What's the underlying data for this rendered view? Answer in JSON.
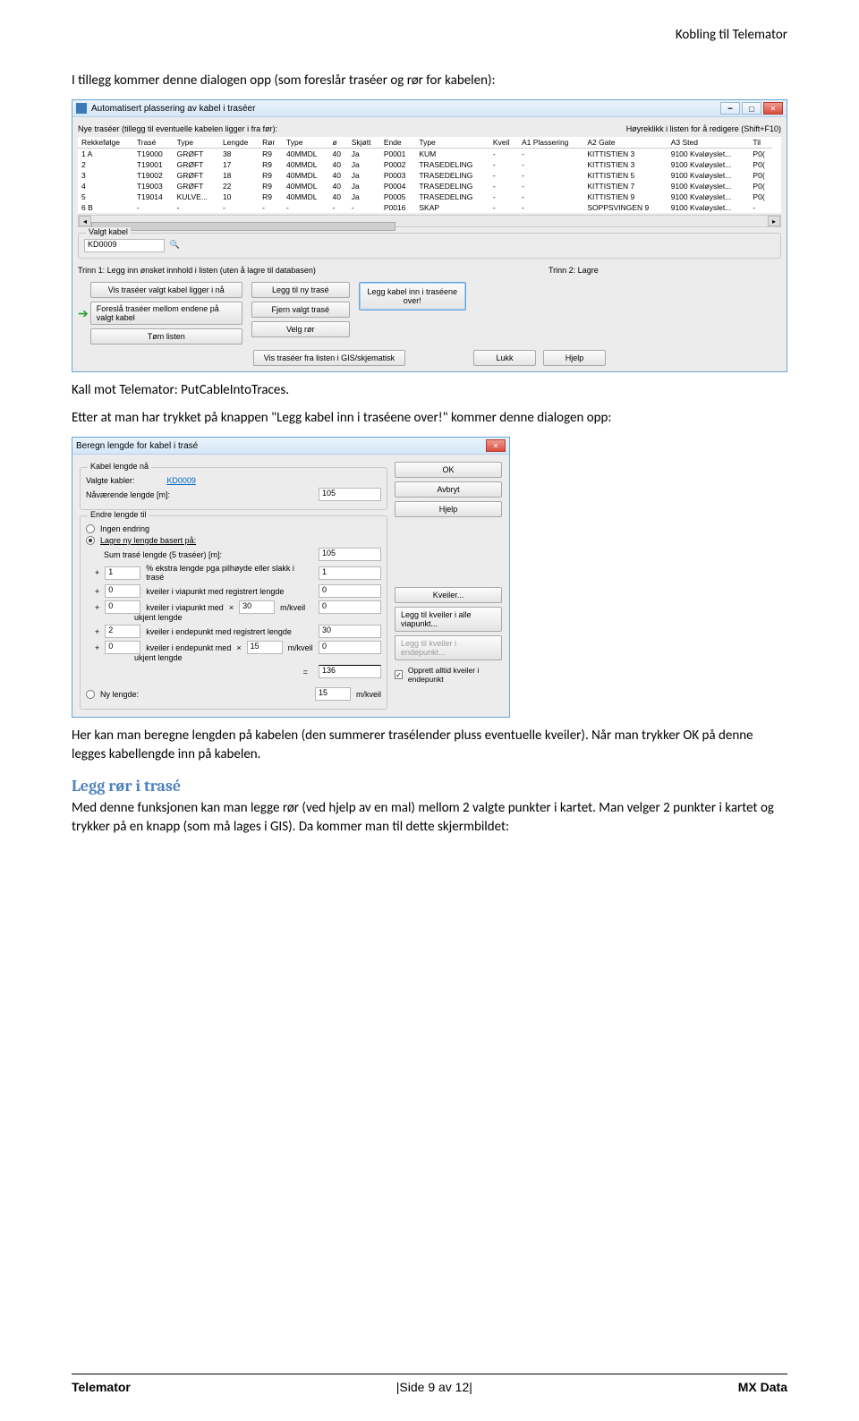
{
  "header": {
    "doc_title": "Kobling til Telemator"
  },
  "intro": {
    "p1": "I tillegg kommer denne dialogen opp (som foreslår traséer og rør for kabelen):"
  },
  "dlg1": {
    "title": "Automatisert plassering av kabel i traséer",
    "left_label": "Nye traséer (tillegg til eventuelle kabelen ligger i fra før):",
    "right_label": "Høyreklikk i listen for å redigere (Shift+F10)",
    "headers": [
      "Rekkefølge",
      "Trasé",
      "Type",
      "Lengde",
      "Rør",
      "Type",
      "ø",
      "Skjøtt",
      "Ende",
      "Type",
      "Kveil",
      "A1 Plassering",
      "A2 Gate",
      "A3 Sted",
      "Til"
    ],
    "rows": [
      [
        "1 A",
        "T19000",
        "GRØFT",
        "38",
        "R9",
        "40MMDL",
        "40",
        "Ja",
        "P0001",
        "KUM",
        "-",
        "-",
        "KITTISTIEN 3",
        "9100 Kvaløyslet...",
        "P0(",
        ""
      ],
      [
        "2",
        "T19001",
        "GRØFT",
        "17",
        "R9",
        "40MMDL",
        "40",
        "Ja",
        "P0002",
        "TRASEDELING",
        "-",
        "-",
        "KITTISTIEN 3",
        "9100 Kvaløyslet...",
        "P0(",
        ""
      ],
      [
        "3",
        "T19002",
        "GRØFT",
        "18",
        "R9",
        "40MMDL",
        "40",
        "Ja",
        "P0003",
        "TRASEDELING",
        "-",
        "-",
        "KITTISTIEN 5",
        "9100 Kvaløyslet...",
        "P0(",
        ""
      ],
      [
        "4",
        "T19003",
        "GRØFT",
        "22",
        "R9",
        "40MMDL",
        "40",
        "Ja",
        "P0004",
        "TRASEDELING",
        "-",
        "-",
        "KITTISTIEN 7",
        "9100 Kvaløyslet...",
        "P0(",
        ""
      ],
      [
        "5",
        "T19014",
        "KULVE...",
        "10",
        "R9",
        "40MMDL",
        "40",
        "Ja",
        "P0005",
        "TRASEDELING",
        "-",
        "-",
        "KITTISTIEN 9",
        "9100 Kvaløyslet...",
        "P0(",
        ""
      ],
      [
        "6 B",
        "-",
        "-",
        "-",
        "-",
        "-",
        "-",
        "-",
        "P0016",
        "SKAP",
        "-",
        "-",
        "SOPPSVINGEN 9",
        "9100 Kvaløyslet...",
        "-",
        ""
      ]
    ],
    "valgt_kabel_label": "Valgt kabel",
    "valgt_kabel_value": "KD0009",
    "trinn1": "Trinn 1: Legg inn ønsket innhold i listen (uten å lagre til databasen)",
    "trinn2": "Trinn 2: Lagre",
    "btn_vis_traseer": "Vis traséer valgt kabel ligger i nå",
    "btn_foresla": "Foreslå traséer mellom endene på valgt kabel",
    "btn_tom": "Tøm listen",
    "btn_legg_ny": "Legg til ny trasé",
    "btn_fjern": "Fjern valgt trasé",
    "btn_velg_ror": "Velg rør",
    "btn_legg_kabel": "Legg kabel inn i traséene over!",
    "btn_vis_fra": "Vis traséer fra listen i GIS/skjematisk",
    "btn_lukk": "Lukk",
    "btn_hjelp": "Hjelp"
  },
  "mid": {
    "p2": "Kall mot Telemator: PutCableIntoTraces.",
    "p3": "Etter at man har trykket på knappen \"Legg kabel inn i traséene over!\" kommer denne dialogen opp:"
  },
  "dlg2": {
    "title": "Beregn lengde for kabel i trasé",
    "grp1_title": "Kabel lengde nå",
    "valgte_kabler": "Valgte kabler:",
    "valgte_kabler_val": "KD0009",
    "nav_lengde": "Nåværende lengde [m]:",
    "nav_lengde_val": "105",
    "btn_ok": "OK",
    "btn_avbryt": "Avbryt",
    "btn_hjelp": "Hjelp",
    "grp2_title": "Endre lengde til",
    "opt_ingen": "Ingen endring",
    "opt_lagre": "Lagre ny lengde basert på:",
    "sum_trase": "Sum trasé lengde (5 traséer) [m]:",
    "sum_trase_val": "105",
    "pct_ekstra": "% ekstra lengde pga pilhøyde eller slakk i trasé",
    "pct_ekstra_prefix": "1",
    "pct_ekstra_val": "1",
    "kv_via_reg": "kveiler i viapunkt med registrert lengde",
    "kv_via_reg_prefix": "0",
    "kv_via_reg_val": "0",
    "kv_via_ukjent": "kveiler i viapunkt med",
    "kv_via_ukjent2": "ukjent lengde",
    "kv_via_ukjent_prefix": "0",
    "kv_via_ukjent_mul": "30",
    "kv_via_ukjent_unit": "m/kveil",
    "kv_via_ukjent_val": "0",
    "kv_end_reg": "kveiler i endepunkt med registrert lengde",
    "kv_end_reg_prefix": "2",
    "kv_end_reg_val": "30",
    "kv_end_ukj": "kveiler i endepunkt med",
    "kv_end_ukj2": "ukjent lengde",
    "kv_end_ukj_prefix": "0",
    "kv_end_ukj_mul": "15",
    "kv_end_ukj_unit": "m/kveil",
    "kv_end_ukj_val": "0",
    "sum_eq": "=",
    "sum_val": "136",
    "btn_kveiler": "Kveiler...",
    "btn_legg_via": "Legg til kveiler i alle viapunkt...",
    "btn_legg_end": "Legg til kveiler i endepunkt...",
    "chk_opprett": "Opprett alltid kveiler i endepunkt",
    "opt_ny": "Ny lengde:",
    "ny_val": "15",
    "ny_unit": "m/kveil"
  },
  "after": {
    "p4": "Her kan man beregne lengden på kabelen (den summerer trasélender pluss eventuelle kveiler). Når man trykker OK på denne legges kabellengde inn på kabelen.",
    "h1": "Legg rør i trasé",
    "p5": "Med denne funksjonen kan man legge rør (ved hjelp av en mal) mellom 2 valgte punkter i kartet. Man velger 2 punkter i kartet og trykker på en knapp (som må lages i GIS). Da kommer man til dette skjermbildet:"
  },
  "footer": {
    "left": "Telemator",
    "mid": "|Side 9 av 12|",
    "right": "MX Data"
  }
}
